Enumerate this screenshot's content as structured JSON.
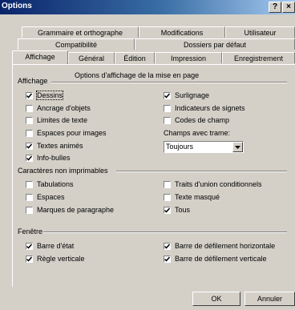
{
  "window": {
    "title": "Options",
    "help_label": "?",
    "close_label": "×"
  },
  "tabs": {
    "row1": [
      "Grammaire et orthographe",
      "Modifications",
      "Utilisateur"
    ],
    "row2": [
      "Compatibilité",
      "Dossiers par défaut"
    ],
    "row3": [
      "Affichage",
      "Général",
      "Édition",
      "Impression",
      "Enregistrement"
    ],
    "active": "Affichage"
  },
  "affichage": {
    "group_label": "Affichage",
    "subtitle": "Options d'affichage de la mise en page",
    "left": [
      {
        "label": "Dessins",
        "checked": true
      },
      {
        "label": "Ancrage d'objets",
        "checked": false
      },
      {
        "label": "Limites de texte",
        "checked": false
      },
      {
        "label": "Espaces pour images",
        "checked": false
      },
      {
        "label": "Textes animés",
        "checked": true
      },
      {
        "label": "Info-bulles",
        "checked": true
      }
    ],
    "right": [
      {
        "label": "Surlignage",
        "checked": true
      },
      {
        "label": "Indicateurs de signets",
        "checked": false
      },
      {
        "label": "Codes de champ",
        "checked": false
      }
    ],
    "champs_label": "Champs avec trame:",
    "champs_value": "Toujours"
  },
  "non_imprimables": {
    "group_label": "Caractères non imprimables",
    "left": [
      {
        "label": "Tabulations",
        "checked": false
      },
      {
        "label": "Espaces",
        "checked": false
      },
      {
        "label": "Marques de paragraphe",
        "checked": false
      }
    ],
    "right": [
      {
        "label": "Traits d'union conditionnels",
        "checked": false
      },
      {
        "label": "Texte masqué",
        "checked": false
      },
      {
        "label": "Tous",
        "checked": true
      }
    ]
  },
  "fenetre": {
    "group_label": "Fenêtre",
    "left": [
      {
        "label": "Barre d'état",
        "checked": true
      },
      {
        "label": "Règle verticale",
        "checked": true
      }
    ],
    "right": [
      {
        "label": "Barre de défilement horizontale",
        "checked": true
      },
      {
        "label": "Barre de défilement verticale",
        "checked": true
      }
    ]
  },
  "buttons": {
    "ok": "OK",
    "cancel": "Annuler"
  }
}
